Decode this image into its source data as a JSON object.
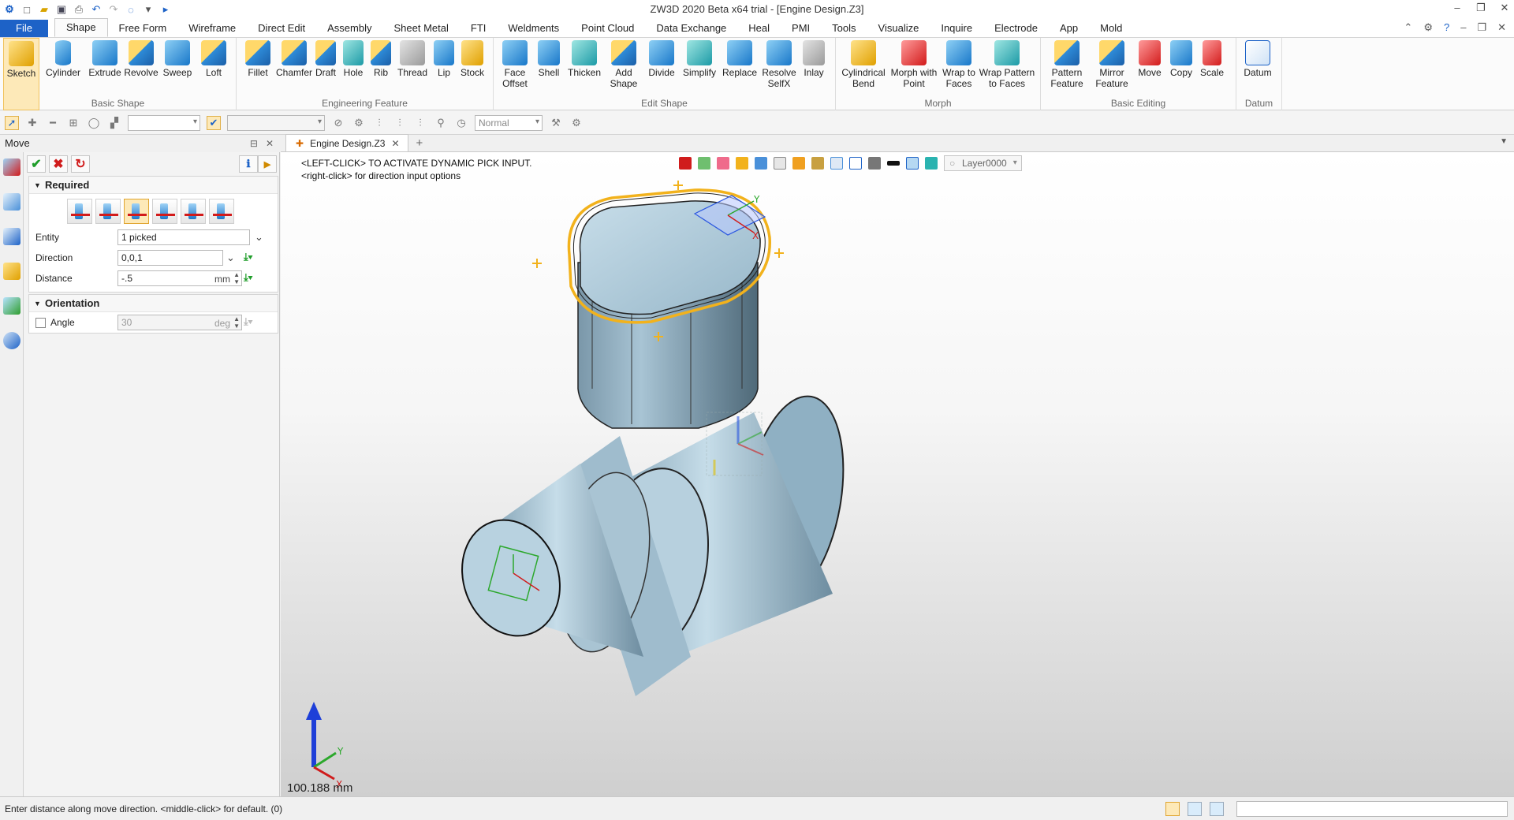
{
  "window": {
    "title": "ZW3D 2020 Beta x64 trial - [Engine Design.Z3]",
    "controls": [
      "minimize",
      "restore",
      "close"
    ]
  },
  "quick_access": [
    "zw3d-logo-icon",
    "new-icon",
    "open-icon",
    "save-icon",
    "print-icon",
    "undo-icon",
    "redo-icon",
    "select-icon",
    "dropdown-icon",
    "run-icon"
  ],
  "ribbon_tabs": [
    "File",
    "Shape",
    "Free Form",
    "Wireframe",
    "Direct Edit",
    "Assembly",
    "Sheet Metal",
    "FTI",
    "Weldments",
    "Point Cloud",
    "Data Exchange",
    "Heal",
    "PMI",
    "Tools",
    "Visualize",
    "Inquire",
    "Electrode",
    "App",
    "Mold"
  ],
  "active_tab": "Shape",
  "ribbon_groups": [
    {
      "label": "Basic Shape",
      "buttons": [
        {
          "label": "Sketch",
          "icon": "sketch-icon"
        },
        {
          "label": "Cylinder",
          "icon": "cylinder-icon"
        },
        {
          "label": "Extrude",
          "icon": "extrude-icon"
        },
        {
          "label": "Revolve",
          "icon": "revolve-icon"
        },
        {
          "label": "Sweep",
          "icon": "sweep-icon"
        },
        {
          "label": "Loft",
          "icon": "loft-icon"
        }
      ]
    },
    {
      "label": "Engineering Feature",
      "buttons": [
        {
          "label": "Fillet",
          "icon": "fillet-icon"
        },
        {
          "label": "Chamfer",
          "icon": "chamfer-icon"
        },
        {
          "label": "Draft",
          "icon": "draft-icon"
        },
        {
          "label": "Hole",
          "icon": "hole-icon"
        },
        {
          "label": "Rib",
          "icon": "rib-icon"
        },
        {
          "label": "Thread",
          "icon": "thread-icon"
        },
        {
          "label": "Lip",
          "icon": "lip-icon"
        },
        {
          "label": "Stock",
          "icon": "stock-icon"
        }
      ]
    },
    {
      "label": "Edit Shape",
      "buttons": [
        {
          "label": "Face\nOffset",
          "icon": "face-offset-icon"
        },
        {
          "label": "Shell",
          "icon": "shell-icon"
        },
        {
          "label": "Thicken",
          "icon": "thicken-icon"
        },
        {
          "label": "Add\nShape",
          "icon": "add-shape-icon"
        },
        {
          "label": "Divide",
          "icon": "divide-icon"
        },
        {
          "label": "Simplify",
          "icon": "simplify-icon"
        },
        {
          "label": "Replace",
          "icon": "replace-icon"
        },
        {
          "label": "Resolve\nSelfX",
          "icon": "resolve-selfx-icon"
        },
        {
          "label": "Inlay",
          "icon": "inlay-icon"
        }
      ]
    },
    {
      "label": "Morph",
      "buttons": [
        {
          "label": "Cylindrical\nBend",
          "icon": "cylindrical-bend-icon"
        },
        {
          "label": "Morph with\nPoint",
          "icon": "morph-point-icon"
        },
        {
          "label": "Wrap to\nFaces",
          "icon": "wrap-faces-icon"
        },
        {
          "label": "Wrap Pattern\nto Faces",
          "icon": "wrap-pattern-icon"
        }
      ]
    },
    {
      "label": "Basic Editing",
      "buttons": [
        {
          "label": "Pattern\nFeature",
          "icon": "pattern-feature-icon"
        },
        {
          "label": "Mirror\nFeature",
          "icon": "mirror-feature-icon"
        },
        {
          "label": "Move",
          "icon": "move-icon"
        },
        {
          "label": "Copy",
          "icon": "copy-icon"
        },
        {
          "label": "Scale",
          "icon": "scale-icon"
        }
      ]
    },
    {
      "label": "Datum",
      "buttons": [
        {
          "label": "Datum",
          "icon": "datum-icon"
        }
      ]
    }
  ],
  "toolbar2": {
    "filter_value": "",
    "render_mode": "Normal"
  },
  "panel": {
    "title": "Move",
    "required_label": "Required",
    "orientation_label": "Orientation",
    "fields": {
      "entity_label": "Entity",
      "entity_value": "1 picked",
      "direction_label": "Direction",
      "direction_value": "0,0,1",
      "distance_label": "Distance",
      "distance_value": "-.5",
      "distance_unit": "mm",
      "angle_label": "Angle",
      "angle_value": "30",
      "angle_unit": "deg"
    }
  },
  "document": {
    "tab_label": "Engine Design.Z3",
    "prompt_line1": "<LEFT-CLICK> TO ACTIVATE DYNAMIC PICK INPUT.",
    "prompt_line2": "<right-click> for direction input options",
    "layer": "Layer0000",
    "measurement": "100.188 mm"
  },
  "status": {
    "message": "Enter distance along move direction.  <middle-click> for default. (0)"
  },
  "colors": {
    "accent": "#1d62c7",
    "part_body": "#a9c7d8",
    "highlight": "#f2b21c"
  }
}
